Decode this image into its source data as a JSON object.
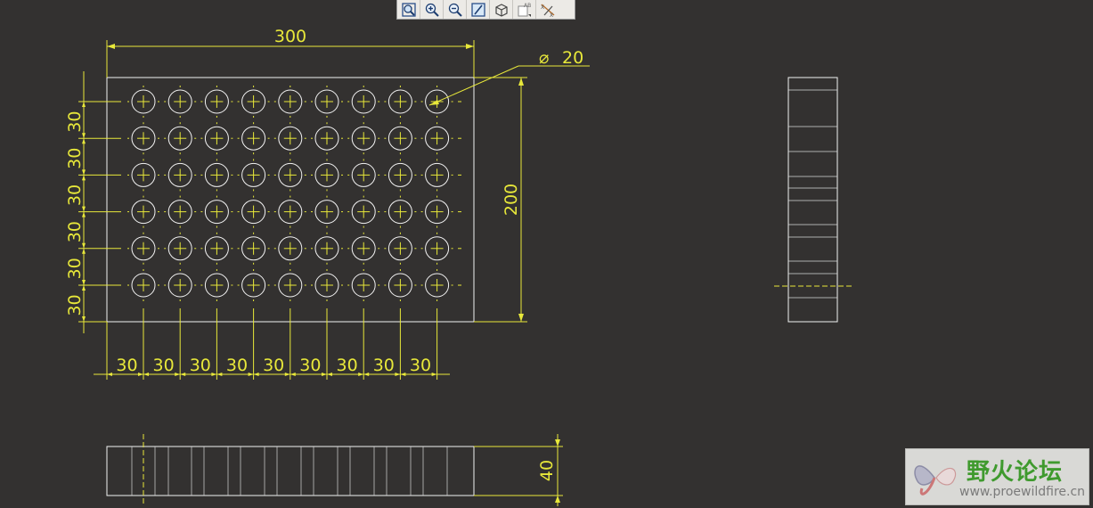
{
  "toolbar": {
    "buttons": [
      {
        "name": "zoom-fit-icon"
      },
      {
        "name": "zoom-in-icon"
      },
      {
        "name": "zoom-out-icon"
      },
      {
        "name": "repaint-icon"
      },
      {
        "name": "display-style-icon"
      },
      {
        "name": "annotation-display-icon"
      },
      {
        "name": "datum-display-icon"
      }
    ]
  },
  "drawing": {
    "width_dim": "300",
    "height_dim": "200",
    "diameter_dim": "20",
    "diameter_symbol": "⌀",
    "row_spacing_dims": [
      "30",
      "30",
      "30",
      "30",
      "30",
      "30"
    ],
    "col_spacing_dims": [
      "30",
      "30",
      "30",
      "30",
      "30",
      "30",
      "30",
      "30",
      "30"
    ],
    "thickness_dim": "40",
    "hole_rows": 6,
    "hole_cols": 9
  },
  "watermark": {
    "title": "野火论坛",
    "url": "www.proewildfire.cn"
  },
  "colors": {
    "background": "#333130",
    "dimension": "#e8e83a",
    "geometry": "#f2f2f2"
  }
}
